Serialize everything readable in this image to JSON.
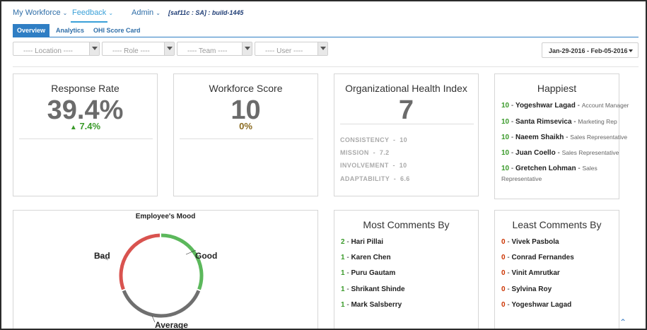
{
  "nav": {
    "items": [
      {
        "label": "My Workforce",
        "active": false
      },
      {
        "label": "Feedback",
        "active": true
      },
      {
        "label": "Admin",
        "active": false
      }
    ],
    "build_label": "[saf11c : SA] : build-1445"
  },
  "subtabs": [
    "Overview",
    "Analytics",
    "OHI Score Card"
  ],
  "filters": {
    "location": "---- Location ----",
    "role": "---- Role ----",
    "team": "---- Team ----",
    "user": "---- User ----"
  },
  "date_range": "Jan-29-2016 - Feb-05-2016",
  "response_rate": {
    "title": "Response Rate",
    "value": "39.4%",
    "delta": "7.4%"
  },
  "workforce_score": {
    "title": "Workforce Score",
    "value": "10",
    "delta": "0%"
  },
  "ohi": {
    "title": "Organizational Health Index",
    "value": "7",
    "metrics": [
      {
        "label": "CONSISTENCY",
        "value": "10"
      },
      {
        "label": "MISSION",
        "value": "7.2"
      },
      {
        "label": "INVOLVEMENT",
        "value": "10"
      },
      {
        "label": "ADAPTABILITY",
        "value": "6.6"
      }
    ]
  },
  "happiest": {
    "title": "Happiest",
    "items": [
      {
        "score": "10",
        "name": "Yogeshwar Lagad",
        "role": "Account Manager"
      },
      {
        "score": "10",
        "name": "Santa Rimsevica",
        "role": "Marketing Rep"
      },
      {
        "score": "10",
        "name": "Naeem Shaikh",
        "role": "Sales Representative"
      },
      {
        "score": "10",
        "name": "Juan Coello",
        "role": "Sales Representative"
      },
      {
        "score": "10",
        "name": "Gretchen Lohman",
        "role": "Sales",
        "role_line2": "Representative"
      }
    ]
  },
  "mood": {
    "title": "Employee's Mood",
    "labels": {
      "bad": "Bad",
      "good": "Good",
      "average": "Average"
    },
    "colors": {
      "bad": "#d9534f",
      "good": "#5cb85c",
      "average": "#6f6f6f"
    }
  },
  "most_comments": {
    "title": "Most Comments By",
    "items": [
      {
        "count": "2",
        "name": "Hari Pillai"
      },
      {
        "count": "1",
        "name": "Karen Chen"
      },
      {
        "count": "1",
        "name": "Puru Gautam"
      },
      {
        "count": "1",
        "name": "Shrikant Shinde"
      },
      {
        "count": "1",
        "name": "Mark Salsberry"
      }
    ]
  },
  "least_comments": {
    "title": "Least Comments By",
    "items": [
      {
        "count": "0",
        "name": "Vivek Pasbola"
      },
      {
        "count": "0",
        "name": "Conrad Fernandes"
      },
      {
        "count": "0",
        "name": "Vinit Amrutkar"
      },
      {
        "count": "0",
        "name": "Sylvina Roy"
      },
      {
        "count": "0",
        "name": "Yogeshwar Lagad"
      }
    ]
  },
  "icons": {
    "scroll_top": "double-chevron-up-icon",
    "delta_up": "triangle-up-icon"
  }
}
